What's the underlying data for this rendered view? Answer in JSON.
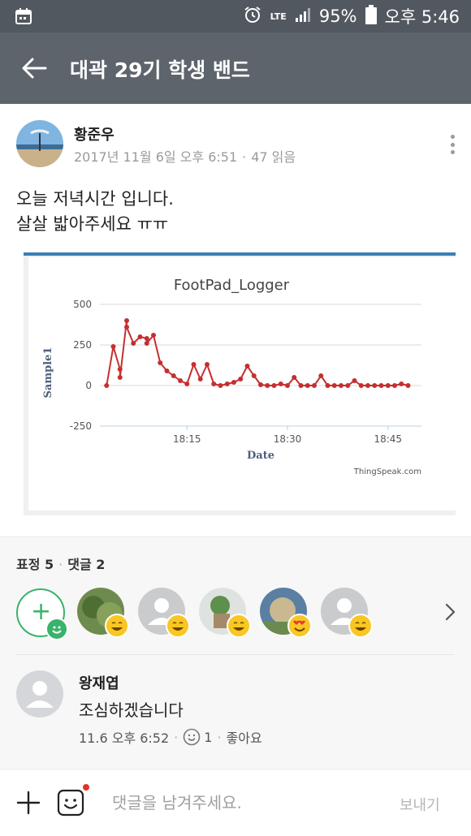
{
  "status_bar": {
    "lte": "LTE",
    "battery": "95%",
    "time": "오후 5:46"
  },
  "app_bar": {
    "title": "대곽 29기 학생 밴드"
  },
  "post": {
    "author": "황준우",
    "date": "2017년 11월 6일 오후 6:51",
    "reads": "47 읽음",
    "body_lines": [
      "오늘 저녁시간 입니다.",
      "살살 밟아주세요 ㅠㅠ"
    ]
  },
  "chart_data": {
    "type": "line",
    "title": "FootPad_Logger",
    "xlabel": "Date",
    "ylabel": "Sample1",
    "ylim": [
      -250,
      500
    ],
    "yticks": [
      500,
      250,
      0,
      -250
    ],
    "xticks": [
      "18:15",
      "18:30",
      "18:45"
    ],
    "watermark": "ThingSpeak.com",
    "series_color": "#c62f2f",
    "x": [
      "18:03",
      "18:04",
      "18:05",
      "18:05",
      "18:06",
      "18:06",
      "18:07",
      "18:08",
      "18:09",
      "18:09",
      "18:10",
      "18:11",
      "18:12",
      "18:13",
      "18:14",
      "18:15",
      "18:16",
      "18:17",
      "18:18",
      "18:19",
      "18:20",
      "18:21",
      "18:22",
      "18:23",
      "18:24",
      "18:25",
      "18:26",
      "18:27",
      "18:28",
      "18:29",
      "18:30",
      "18:31",
      "18:32",
      "18:33",
      "18:34",
      "18:35",
      "18:36",
      "18:37",
      "18:38",
      "18:39",
      "18:40",
      "18:41",
      "18:42",
      "18:43",
      "18:44",
      "18:45",
      "18:46",
      "18:47",
      "18:48"
    ],
    "y": [
      0,
      240,
      100,
      50,
      400,
      360,
      260,
      300,
      290,
      260,
      310,
      140,
      90,
      60,
      30,
      10,
      130,
      40,
      130,
      10,
      0,
      10,
      20,
      40,
      120,
      60,
      5,
      0,
      0,
      10,
      0,
      50,
      0,
      0,
      0,
      60,
      0,
      0,
      0,
      0,
      30,
      0,
      0,
      0,
      0,
      0,
      0,
      10,
      0
    ]
  },
  "reactions": {
    "count_label": "표정 5",
    "comment_label": "댓글 2"
  },
  "comment": {
    "author": "왕재엽",
    "text": "조심하겠습니다",
    "time": "11.6 오후 6:52",
    "like_count": "1",
    "like_label": "좋아요"
  },
  "input_bar": {
    "placeholder": "댓글을 남겨주세요.",
    "send_label": "보내기"
  },
  "colors": {
    "status_bar": "#52585f",
    "app_bar": "#5d646b",
    "accent_green": "#39b36b",
    "chart_line": "#c62f2f"
  },
  "icons": {
    "back": "arrow-left-icon",
    "more": "more-vertical-icon",
    "add_reaction": "add-reaction-icon",
    "chevron": "chevron-right-icon",
    "plus": "plus-icon",
    "sticker": "sticker-icon"
  }
}
